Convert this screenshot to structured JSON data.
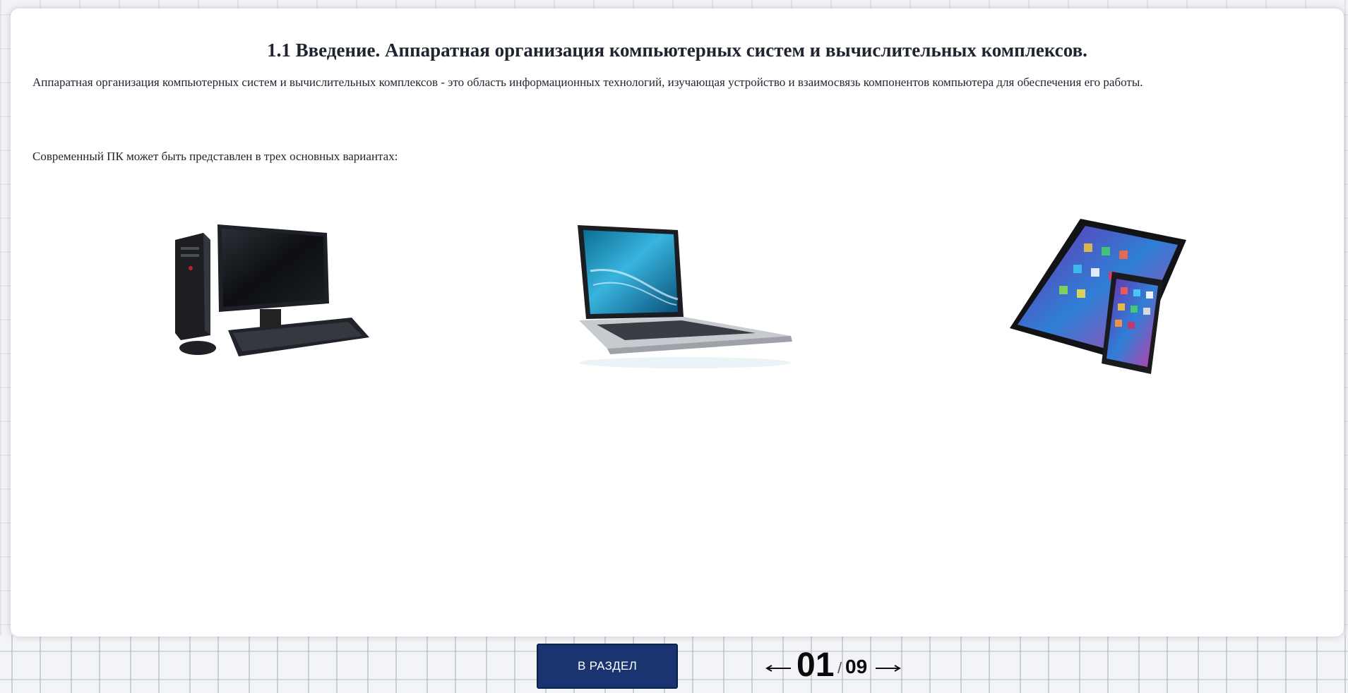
{
  "page": {
    "title": "1.1 Введение. Аппаратная организация компьютерных систем и вычислительных комплексов.",
    "intro": "Аппаратная организация компьютерных систем и вычислительных комплексов - это область информационных технологий, изучающая устройство и взаимосвязь компонентов компьютера для обеспечения его работы.",
    "variants_lead": "Современный ПК может быть представлен в трех основных вариантах:"
  },
  "devices": [
    {
      "icon": "desktop-computer-icon"
    },
    {
      "icon": "laptop-icon"
    },
    {
      "icon": "tablet-and-smartphone-icon"
    }
  ],
  "footer": {
    "to_section_label": "В РАЗДЕЛ",
    "current_page": "01",
    "separator": "/",
    "total_pages": "09"
  },
  "colors": {
    "button_bg": "#1a3470",
    "card_bg": "#ffffff",
    "background_pattern": "#f2f3f6"
  }
}
